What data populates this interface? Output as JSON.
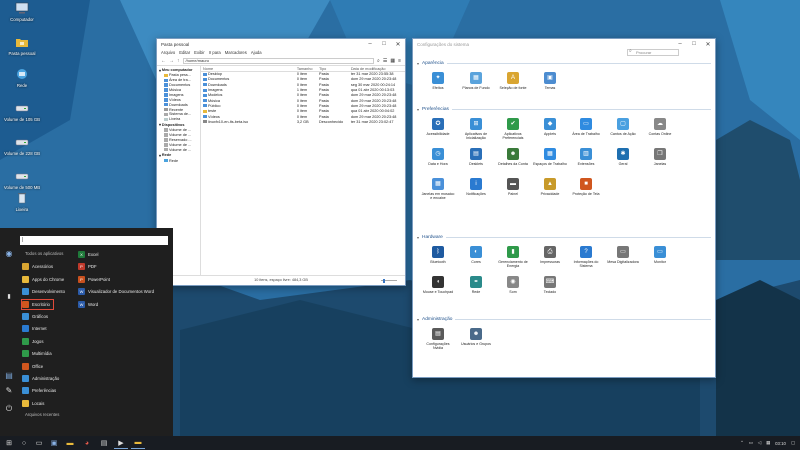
{
  "desktop": {
    "icons": [
      {
        "label": "Computador",
        "icon": "computer-icon"
      },
      {
        "label": "Pasta pessoal",
        "icon": "home-folder-icon"
      },
      {
        "label": "Rede",
        "icon": "network-icon"
      },
      {
        "label": "Volume de 105 GB",
        "icon": "drive-icon"
      },
      {
        "label": "Volume de 228 GB",
        "icon": "drive-icon"
      },
      {
        "label": "Volume de 500 MB",
        "icon": "drive-icon"
      },
      {
        "label": "Lixeira",
        "icon": "trash-icon"
      }
    ]
  },
  "file_manager": {
    "title": "Pasta pessoal",
    "menu": [
      "Arquivo",
      "Editar",
      "Exibir",
      "Ir para",
      "Marcadores",
      "Ajuda"
    ],
    "path": "/home/mauro",
    "sidebar": {
      "sections": [
        {
          "title": "Meu computador",
          "items": [
            "Pasta pess...",
            "Área de tra...",
            "Documentos",
            "Música",
            "Imagens",
            "Vídeos",
            "Downloads",
            "Recente",
            "Sistema de...",
            "Lixeira"
          ]
        },
        {
          "title": "Dispositivos",
          "items": [
            "Volume de ...",
            "Volume de ...",
            "Reservado ...",
            "Volume de ...",
            "Volume de ..."
          ]
        },
        {
          "title": "Rede",
          "items": [
            "Rede"
          ]
        }
      ]
    },
    "columns": [
      "Nome",
      "Tamanho",
      "Tipo",
      "Data de modificação"
    ],
    "rows": [
      {
        "name": "Desktop",
        "size": "0 item",
        "type": "Pasta",
        "date": "ter 31 mar 2020 23:55:38",
        "color": "#4a90d9"
      },
      {
        "name": "Documentos",
        "size": "0 item",
        "type": "Pasta",
        "date": "dom 29 mar 2020 20:23:48",
        "color": "#4a90d9"
      },
      {
        "name": "Downloads",
        "size": "0 item",
        "type": "Pasta",
        "date": "seg 30 mar 2020 00:24:14",
        "color": "#4a90d9"
      },
      {
        "name": "Imagens",
        "size": "1 item",
        "type": "Pasta",
        "date": "qua 01 abr 2020 00:13:03",
        "color": "#4a90d9"
      },
      {
        "name": "Modelos",
        "size": "0 item",
        "type": "Pasta",
        "date": "dom 29 mar 2020 20:23:48",
        "color": "#4a90d9"
      },
      {
        "name": "Música",
        "size": "0 item",
        "type": "Pasta",
        "date": "dom 29 mar 2020 20:23:48",
        "color": "#4a90d9"
      },
      {
        "name": "Público",
        "size": "0 item",
        "type": "Pasta",
        "date": "dom 29 mar 2020 20:23:48",
        "color": "#4a90d9"
      },
      {
        "name": "teste",
        "size": "0 item",
        "type": "Pasta",
        "date": "qua 01 abr 2020 00:04:02",
        "color": "#e8b93b"
      },
      {
        "name": "Vídeos",
        "size": "0 item",
        "type": "Pasta",
        "date": "dom 29 mar 2020 20:23:48",
        "color": "#4a90d9"
      },
      {
        "name": "linuxfx10-en-lts-beta.iso",
        "size": "3,2 GB",
        "type": "Desconhecido",
        "date": "ter 31 mar 2020 23:02:47",
        "color": "#888888"
      }
    ],
    "status": "10 itens, espaço livre: 484,3 GB"
  },
  "control_panel": {
    "title": "Configurações do sistema",
    "search_placeholder": "Procurar",
    "sections": [
      {
        "title": "Aparência",
        "items": [
          {
            "label": "Efeitos",
            "color": "#3a8fd6",
            "glyph": "✦"
          },
          {
            "label": "Planos de Fundo",
            "color": "#5aa3dc",
            "glyph": "▦"
          },
          {
            "label": "Seleção de fonte",
            "color": "#d9a531",
            "glyph": "A"
          },
          {
            "label": "Temas",
            "color": "#4c8cd0",
            "glyph": "▣"
          }
        ]
      },
      {
        "title": "Preferências",
        "items": [
          {
            "label": "Acessibilidade",
            "color": "#2a6fb8",
            "glyph": "✪"
          },
          {
            "label": "Aplicativos de Inicialização",
            "color": "#3a8fd6",
            "glyph": "⊞"
          },
          {
            "label": "Aplicativos Preferenciais",
            "color": "#2f9a4a",
            "glyph": "✔"
          },
          {
            "label": "Applets",
            "color": "#3a8fd6",
            "glyph": "◆"
          },
          {
            "label": "Área de Trabalho",
            "color": "#2f8be0",
            "glyph": "▭"
          },
          {
            "label": "Cantos de Ação",
            "color": "#4aa0e0",
            "glyph": "▢"
          },
          {
            "label": "Contas Online",
            "color": "#888888",
            "glyph": "☁"
          },
          {
            "label": "Data e Hora",
            "color": "#3a8fd6",
            "glyph": "◷"
          },
          {
            "label": "Desklets",
            "color": "#2a6fb8",
            "glyph": "▤"
          },
          {
            "label": "Detalhes da Conta",
            "color": "#3a7a3a",
            "glyph": "☻"
          },
          {
            "label": "Espaços de Trabalho",
            "color": "#2f8be0",
            "glyph": "▦"
          },
          {
            "label": "Extensões",
            "color": "#3a8fd6",
            "glyph": "▥"
          },
          {
            "label": "Geral",
            "color": "#1e6fb0",
            "glyph": "✱"
          },
          {
            "label": "Janelas",
            "color": "#777777",
            "glyph": "❐"
          },
          {
            "label": "Janelas em mosaico e encaixe",
            "color": "#4a90d9",
            "glyph": "▦"
          },
          {
            "label": "Notificações",
            "color": "#2a7ad0",
            "glyph": "i"
          },
          {
            "label": "Painel",
            "color": "#555555",
            "glyph": "▬"
          },
          {
            "label": "Privacidade",
            "color": "#c89a2a",
            "glyph": "▲"
          },
          {
            "label": "Proteção de Tela",
            "color": "#d0561e",
            "glyph": "■"
          }
        ]
      },
      {
        "title": "Hardware",
        "items": [
          {
            "label": "Bluetooth",
            "color": "#1e5aa0",
            "glyph": "ᛒ"
          },
          {
            "label": "Cores",
            "color": "#3a8fd6",
            "glyph": "◐"
          },
          {
            "label": "Gerenciamento de Energia",
            "color": "#2f9a4a",
            "glyph": "▮"
          },
          {
            "label": "Impressoras",
            "color": "#666666",
            "glyph": "⎙"
          },
          {
            "label": "Informações do Sistema",
            "color": "#2a7ad0",
            "glyph": "?"
          },
          {
            "label": "Mesa Digitalizadora",
            "color": "#777777",
            "glyph": "▭"
          },
          {
            "label": "Monitor",
            "color": "#3a8fd6",
            "glyph": "▭"
          },
          {
            "label": "Mouse e Touchpad",
            "color": "#333333",
            "glyph": "◖"
          },
          {
            "label": "Rede",
            "color": "#2a8a8a",
            "glyph": "⚭"
          },
          {
            "label": "Som",
            "color": "#888888",
            "glyph": "◉"
          },
          {
            "label": "Teclado",
            "color": "#777777",
            "glyph": "⌨"
          }
        ]
      },
      {
        "title": "Administração",
        "items": [
          {
            "label": "Configurações Nvidia",
            "color": "#5a5a5a",
            "glyph": "▤"
          },
          {
            "label": "Usuários e Grupos",
            "color": "#4a6a8a",
            "glyph": "☻"
          }
        ]
      }
    ]
  },
  "start_menu": {
    "search_value": "",
    "categories": [
      {
        "label": "Todos os aplicativos",
        "color": ""
      },
      {
        "label": "Acessórios",
        "color": "#d9a531"
      },
      {
        "label": "Apps do Chrome",
        "color": "#e8b93b"
      },
      {
        "label": "Desenvolvimento",
        "color": "#3a8fd6"
      },
      {
        "label": "Escritório",
        "color": "#d0561e"
      },
      {
        "label": "Gráficos",
        "color": "#3a8fd6"
      },
      {
        "label": "Internet",
        "color": "#2a7ad0"
      },
      {
        "label": "Jogos",
        "color": "#2f9a4a"
      },
      {
        "label": "Multimídia",
        "color": "#2f9a4a"
      },
      {
        "label": "Office",
        "color": "#d0561e"
      },
      {
        "label": "Administração",
        "color": "#3a8fd6"
      },
      {
        "label": "Preferências",
        "color": "#3a8fd6"
      },
      {
        "label": "Locais",
        "color": "#e8b93b"
      },
      {
        "label": "Arquivos recentes",
        "color": ""
      }
    ],
    "apps": [
      {
        "label": "Excel",
        "color": "#1f7a3a",
        "glyph": "X"
      },
      {
        "label": "PDF",
        "color": "#c0392b",
        "glyph": "P"
      },
      {
        "label": "PowerPoint",
        "color": "#c8501e",
        "glyph": "P"
      },
      {
        "label": "Visualizador de Documentos Word",
        "color": "#2a5aa8",
        "glyph": "W"
      },
      {
        "label": "Word",
        "color": "#2a5aa8",
        "glyph": "W"
      }
    ],
    "selected_category": "Escritório"
  },
  "taskbar": {
    "clock": "03:10"
  },
  "colors": {
    "accent": "#3b78c4",
    "taskbar": "#181c22",
    "start_menu": "#1f1f1f"
  }
}
